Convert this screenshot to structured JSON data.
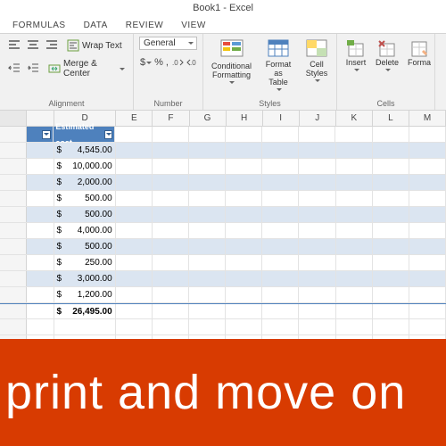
{
  "title": "Book1 - Excel",
  "tabs": [
    "FORMULAS",
    "DATA",
    "REVIEW",
    "VIEW"
  ],
  "ribbon": {
    "wrap": "Wrap Text",
    "merge": "Merge & Center",
    "align_label": "Alignment",
    "numfmt": "General",
    "num_label": "Number",
    "cond": "Conditional\nFormatting",
    "fmt_table": "Format as\nTable",
    "cell_styles": "Cell\nStyles",
    "styles_label": "Styles",
    "insert": "Insert",
    "delete": "Delete",
    "format": "Forma",
    "cells_label": "Cells"
  },
  "cols": [
    "D",
    "E",
    "F",
    "G",
    "H",
    "I",
    "J",
    "K",
    "L",
    "M"
  ],
  "header_col": "Estimated cost",
  "data": [
    {
      "v": "4,545.00"
    },
    {
      "v": "10,000.00"
    },
    {
      "v": "2,000.00"
    },
    {
      "v": "500.00"
    },
    {
      "v": "500.00"
    },
    {
      "v": "4,000.00"
    },
    {
      "v": "500.00"
    },
    {
      "v": "250.00"
    },
    {
      "v": "3,000.00"
    },
    {
      "v": "1,200.00"
    }
  ],
  "total": "26,495.00",
  "banner": "print and move on"
}
